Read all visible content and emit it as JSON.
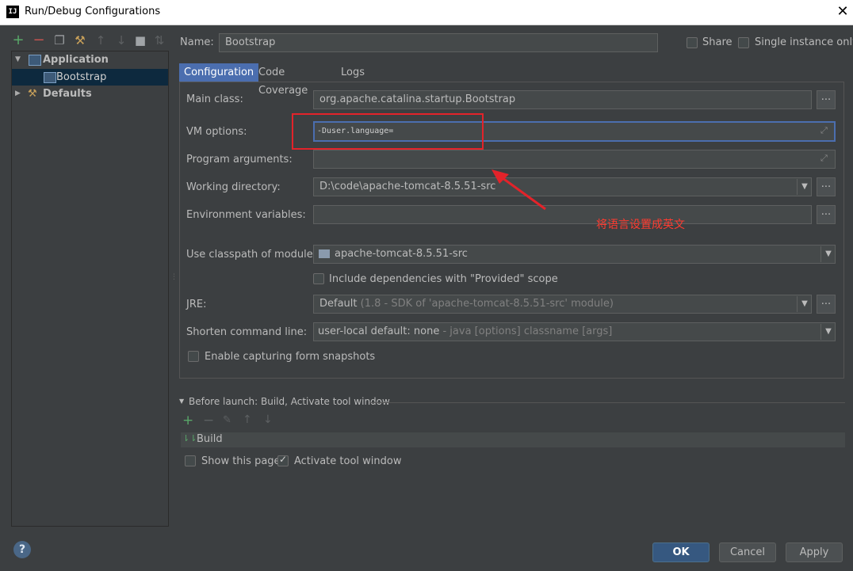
{
  "window": {
    "title": "Run/Debug Configurations",
    "app_icon": "IJ"
  },
  "left_toolbar": {
    "icons": [
      "add-icon",
      "remove-icon",
      "copy-icon",
      "wrench-icon",
      "move-up-icon",
      "move-down-icon",
      "folder-icon",
      "sort-icon"
    ]
  },
  "tree": {
    "items": [
      {
        "label": "Application",
        "expanded": true
      },
      {
        "label": "Bootstrap",
        "selected": true
      },
      {
        "label": "Defaults",
        "expanded": false
      }
    ]
  },
  "top": {
    "name_label": "Name:",
    "name_value": "Bootstrap",
    "share_label": "Share",
    "single_instance_label": "Single instance only"
  },
  "tabs": [
    "Configuration",
    "Code Coverage",
    "Logs"
  ],
  "form": {
    "main_class_label": "Main class:",
    "main_class_value": "org.apache.catalina.startup.Bootstrap",
    "vm_options_label": "VM options:",
    "vm_options_value": "-Duser.language=",
    "program_args_label": "Program arguments:",
    "program_args_value": "",
    "working_dir_label": "Working directory:",
    "working_dir_value": "D:\\code\\apache-tomcat-8.5.51-src",
    "env_vars_label": "Environment variables:",
    "env_vars_value": "",
    "classpath_label": "Use classpath of module:",
    "classpath_value": "apache-tomcat-8.5.51-src",
    "include_deps_label": "Include dependencies with \"Provided\" scope",
    "jre_label": "JRE:",
    "jre_value": "Default",
    "jre_detail": "(1.8 - SDK of 'apache-tomcat-8.5.51-src' module)",
    "shorten_label": "Shorten command line:",
    "shorten_value": "user-local default: none",
    "shorten_detail": "- java [options] classname [args]",
    "enable_capture_label": "Enable capturing form snapshots",
    "browse_label": "..."
  },
  "before_launch": {
    "header": "Before launch: Build, Activate tool window",
    "build_item": "Build",
    "show_page_label": "Show this page",
    "activate_tool_label": "Activate tool window"
  },
  "buttons": {
    "ok": "OK",
    "cancel": "Cancel",
    "apply": "Apply"
  },
  "annotation": {
    "text": "将语言设置成英文",
    "color": "#e3232a"
  },
  "colors": {
    "background": "#3c3f41",
    "accent": "#4b6eaf",
    "selection": "#0d293e",
    "ok_button": "#365880"
  }
}
